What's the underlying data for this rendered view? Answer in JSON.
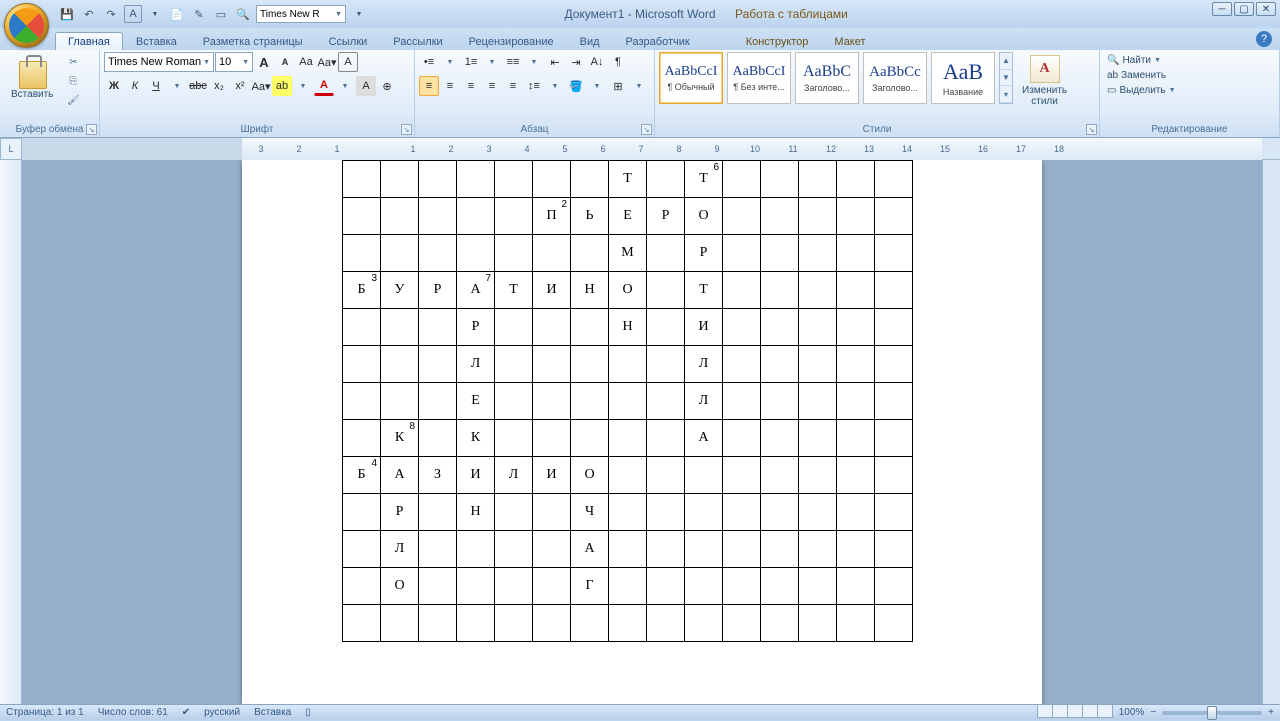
{
  "title": "Документ1 - Microsoft Word",
  "context_title": "Работа с таблицами",
  "qat_font": "Times New R",
  "tabs": [
    "Главная",
    "Вставка",
    "Разметка страницы",
    "Ссылки",
    "Рассылки",
    "Рецензирование",
    "Вид",
    "Разработчик"
  ],
  "context_tabs": [
    "Конструктор",
    "Макет"
  ],
  "active_tab": "Главная",
  "groups": {
    "clipboard": {
      "label": "Буфер обмена",
      "paste": "Вставить"
    },
    "font": {
      "label": "Шрифт",
      "name": "Times New Roman",
      "size": "10",
      "bold": "Ж",
      "italic": "К",
      "underline": "Ч",
      "strike": "abc",
      "sub": "x₂",
      "sup": "x²",
      "aa": "Aa",
      "grow": "A",
      "shrink": "A",
      "clear": "A",
      "hilite": "ab"
    },
    "paragraph": {
      "label": "Абзац"
    },
    "styles": {
      "label": "Стили",
      "items": [
        {
          "sample": "AaBbCcI",
          "name": "¶ Обычный"
        },
        {
          "sample": "AaBbCcI",
          "name": "¶ Без инте..."
        },
        {
          "sample": "AaBbC",
          "name": "Заголово..."
        },
        {
          "sample": "AaBbCc",
          "name": "Заголово..."
        },
        {
          "sample": "АаВ",
          "name": "Название"
        }
      ],
      "change": "Изменить\nстили"
    },
    "editing": {
      "label": "Редактирование",
      "find": "Найти",
      "replace": "Заменить",
      "select": "Выделить"
    }
  },
  "crossword": {
    "cols": 15,
    "rows": 13,
    "cells": [
      {
        "r": 0,
        "c": 7,
        "l": "Т"
      },
      {
        "r": 0,
        "c": 9,
        "l": "Т",
        "n": "6"
      },
      {
        "r": 1,
        "c": 5,
        "l": "П",
        "n": "2"
      },
      {
        "r": 1,
        "c": 6,
        "l": "Ь"
      },
      {
        "r": 1,
        "c": 7,
        "l": "Е"
      },
      {
        "r": 1,
        "c": 8,
        "l": "Р"
      },
      {
        "r": 1,
        "c": 9,
        "l": "О"
      },
      {
        "r": 2,
        "c": 7,
        "l": "М"
      },
      {
        "r": 2,
        "c": 9,
        "l": "Р"
      },
      {
        "r": 3,
        "c": 0,
        "l": "Б",
        "n": "3"
      },
      {
        "r": 3,
        "c": 1,
        "l": "У"
      },
      {
        "r": 3,
        "c": 2,
        "l": "Р"
      },
      {
        "r": 3,
        "c": 3,
        "l": "А",
        "n": "7"
      },
      {
        "r": 3,
        "c": 4,
        "l": "Т"
      },
      {
        "r": 3,
        "c": 5,
        "l": "И"
      },
      {
        "r": 3,
        "c": 6,
        "l": "Н"
      },
      {
        "r": 3,
        "c": 7,
        "l": "О"
      },
      {
        "r": 3,
        "c": 9,
        "l": "Т"
      },
      {
        "r": 4,
        "c": 3,
        "l": "Р"
      },
      {
        "r": 4,
        "c": 7,
        "l": "Н"
      },
      {
        "r": 4,
        "c": 9,
        "l": "И"
      },
      {
        "r": 5,
        "c": 3,
        "l": "Л"
      },
      {
        "r": 5,
        "c": 9,
        "l": "Л"
      },
      {
        "r": 6,
        "c": 3,
        "l": "Е"
      },
      {
        "r": 6,
        "c": 9,
        "l": "Л"
      },
      {
        "r": 7,
        "c": 1,
        "l": "К",
        "n": "8"
      },
      {
        "r": 7,
        "c": 3,
        "l": "К"
      },
      {
        "r": 7,
        "c": 9,
        "l": "А"
      },
      {
        "r": 8,
        "c": 0,
        "l": "Б",
        "n": "4"
      },
      {
        "r": 8,
        "c": 1,
        "l": "А"
      },
      {
        "r": 8,
        "c": 2,
        "l": "З"
      },
      {
        "r": 8,
        "c": 3,
        "l": "И"
      },
      {
        "r": 8,
        "c": 4,
        "l": "Л"
      },
      {
        "r": 8,
        "c": 5,
        "l": "И"
      },
      {
        "r": 8,
        "c": 6,
        "l": "О"
      },
      {
        "r": 9,
        "c": 1,
        "l": "Р"
      },
      {
        "r": 9,
        "c": 3,
        "l": "Н"
      },
      {
        "r": 9,
        "c": 6,
        "l": "Ч"
      },
      {
        "r": 10,
        "c": 1,
        "l": "Л"
      },
      {
        "r": 10,
        "c": 6,
        "l": "А"
      },
      {
        "r": 11,
        "c": 1,
        "l": "О"
      },
      {
        "r": 11,
        "c": 6,
        "l": "Г"
      }
    ]
  },
  "status": {
    "page": "Страница: 1 из 1",
    "words": "Число слов: 61",
    "lang": "русский",
    "mode": "Вставка",
    "zoom": "100%"
  }
}
